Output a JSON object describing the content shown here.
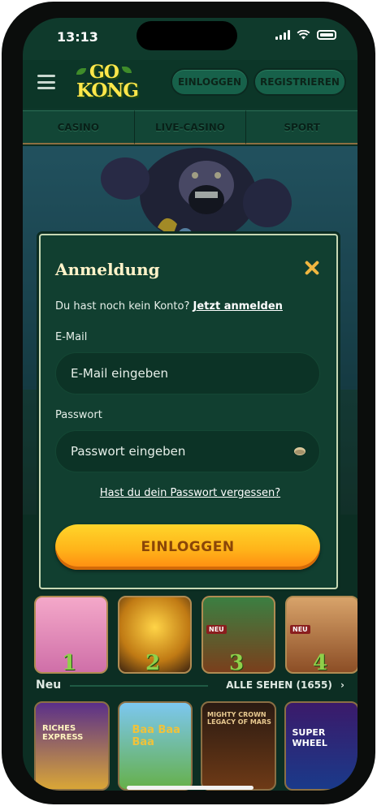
{
  "status_bar": {
    "time": "13:13"
  },
  "header": {
    "logo_line1": "GO",
    "logo_line2": "KONG",
    "login_label": "EINLOGGEN",
    "register_label": "REGISTRIEREN"
  },
  "nav": {
    "tabs": [
      "CASINO",
      "LIVE-CASINO",
      "SPORT"
    ]
  },
  "games": {
    "top": [
      {
        "rank": "1",
        "badge": ""
      },
      {
        "rank": "2",
        "badge": ""
      },
      {
        "rank": "3",
        "badge": "NEU"
      },
      {
        "rank": "4",
        "badge": "NEU"
      }
    ]
  },
  "section_new": {
    "title": "Neu",
    "see_all": "ALLE SEHEN (1655)",
    "cards": [
      "RICHES EXPRESS",
      "Baa Baa Baa",
      "MIGHTY CROWN LEGACY OF MARS",
      "SUPER WHEEL"
    ]
  },
  "modal": {
    "title": "Anmeldung",
    "no_account_text": "Du hast noch kein Konto?",
    "register_link": "Jetzt anmelden",
    "email_label": "E-Mail",
    "email_placeholder": "E-Mail eingeben",
    "password_label": "Passwort",
    "password_placeholder": "Passwort eingeben",
    "forgot_link": "Hast du dein Passwort vergessen?",
    "login_button": "EINLOGGEN"
  },
  "colors": {
    "accent_gold": "#ffb41a",
    "primary_green": "#113f30",
    "close_icon": "#f0b640"
  }
}
